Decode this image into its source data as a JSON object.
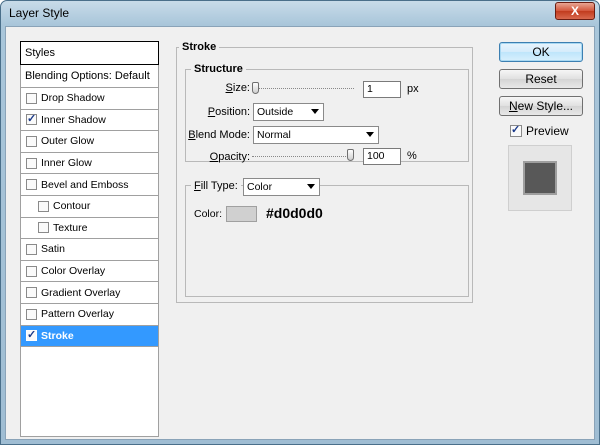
{
  "window": {
    "title": "Layer Style",
    "close_glyph": "X"
  },
  "sidebar": {
    "header": "Styles",
    "blending_options": "Blending Options: Default",
    "items": [
      {
        "label": "Drop Shadow",
        "checked": false,
        "indent": false,
        "selected": false
      },
      {
        "label": "Inner Shadow",
        "checked": true,
        "indent": false,
        "selected": false
      },
      {
        "label": "Outer Glow",
        "checked": false,
        "indent": false,
        "selected": false
      },
      {
        "label": "Inner Glow",
        "checked": false,
        "indent": false,
        "selected": false
      },
      {
        "label": "Bevel and Emboss",
        "checked": false,
        "indent": false,
        "selected": false
      },
      {
        "label": "Contour",
        "checked": false,
        "indent": true,
        "selected": false
      },
      {
        "label": "Texture",
        "checked": false,
        "indent": true,
        "selected": false
      },
      {
        "label": "Satin",
        "checked": false,
        "indent": false,
        "selected": false
      },
      {
        "label": "Color Overlay",
        "checked": false,
        "indent": false,
        "selected": false
      },
      {
        "label": "Gradient Overlay",
        "checked": false,
        "indent": false,
        "selected": false
      },
      {
        "label": "Pattern Overlay",
        "checked": false,
        "indent": false,
        "selected": false
      },
      {
        "label": "Stroke",
        "checked": true,
        "indent": false,
        "selected": true
      }
    ]
  },
  "stroke": {
    "title": "Stroke",
    "structure_label": "Structure",
    "size": {
      "label_u": "S",
      "label_rest": "ize:",
      "value": "1",
      "unit": "px",
      "level": 0.0
    },
    "position": {
      "label_u": "P",
      "label_rest": "osition:",
      "value": "Outside"
    },
    "blend_mode": {
      "label_u": "B",
      "label_rest": "lend Mode:",
      "value": "Normal"
    },
    "opacity": {
      "label_u": "O",
      "label_rest": "pacity:",
      "value": "100",
      "unit": "%",
      "level": 1.0
    },
    "fill_type": {
      "label_u": "F",
      "label_rest": "ill Type:",
      "value": "Color"
    },
    "color": {
      "label": "Color:",
      "swatch": "#d0d0d0",
      "hex_text": "#d0d0d0"
    }
  },
  "buttons": {
    "ok": "OK",
    "reset": "Reset",
    "new_style_u": "N",
    "new_style_rest": "ew Style...",
    "preview_label": "Preview",
    "preview_checked": true
  },
  "colors": {
    "selection": "#3399ff",
    "preview_fill": "#585858"
  }
}
